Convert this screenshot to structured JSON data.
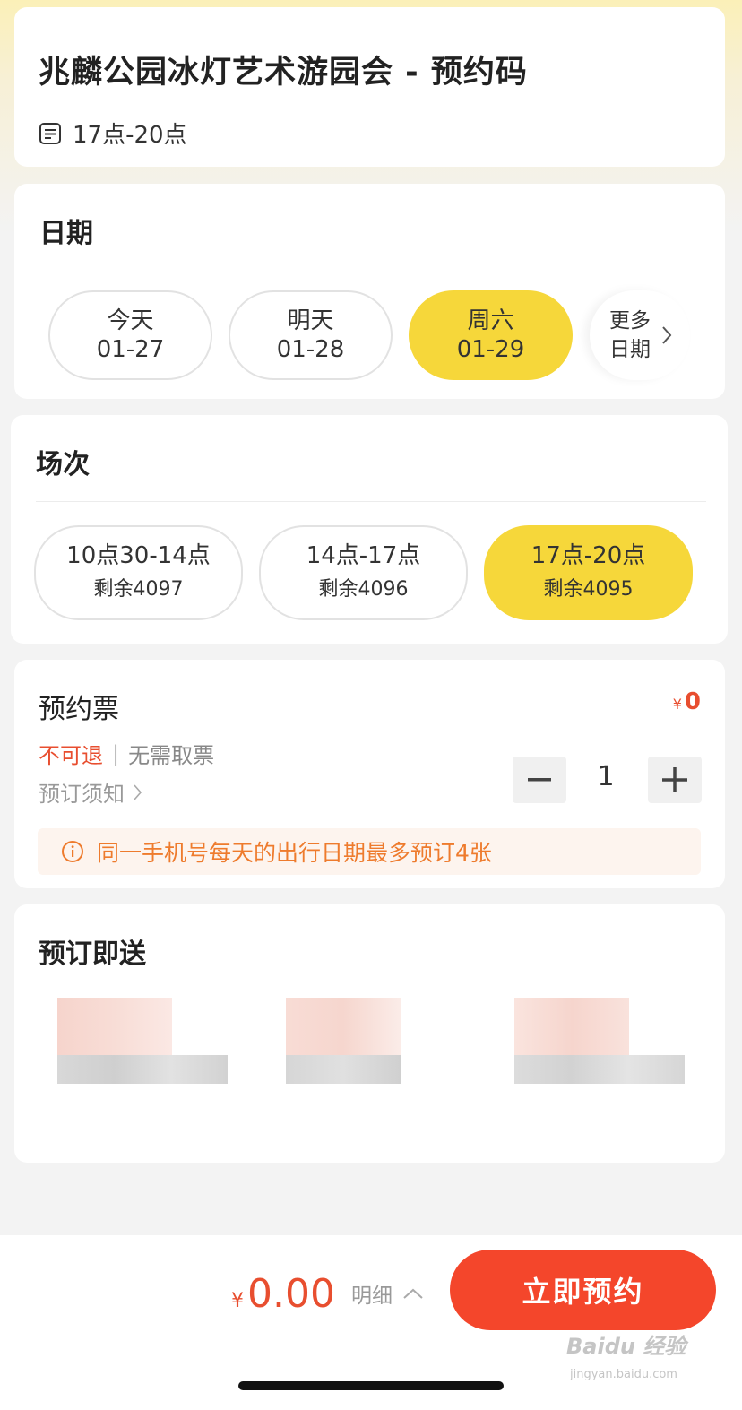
{
  "header": {
    "title": "兆麟公园冰灯艺术游园会 - 预约码",
    "session_time": "17点-20点",
    "icon": "document-list-icon"
  },
  "date_section": {
    "title": "日期",
    "dates": [
      {
        "day": "今天",
        "date": "01-27",
        "selected": false
      },
      {
        "day": "明天",
        "date": "01-28",
        "selected": false
      },
      {
        "day": "周六",
        "date": "01-29",
        "selected": true
      }
    ],
    "more_line1": "更多",
    "more_line2": "日期"
  },
  "session_section": {
    "title": "场次",
    "sessions": [
      {
        "time": "10点30-14点",
        "remaining": "剩余4097",
        "selected": false
      },
      {
        "time": "14点-17点",
        "remaining": "剩余4096",
        "selected": false
      },
      {
        "time": "17点-20点",
        "remaining": "剩余4095",
        "selected": true
      }
    ]
  },
  "ticket_section": {
    "title": "预约票",
    "currency": "¥",
    "price": "0",
    "non_refundable": "不可退",
    "separator": "|",
    "no_pickup": "无需取票",
    "booking_notice": "预订须知",
    "quantity": "1",
    "limit_notice": "同一手机号每天的出行日期最多预订4张"
  },
  "gift_section": {
    "title": "预订即送"
  },
  "bottom_bar": {
    "currency": "¥",
    "total": "0.00",
    "detail_label": "明细",
    "book_button": "立即预约"
  },
  "watermark": {
    "brand": "Baidu 经验",
    "url": "jingyan.baidu.com"
  },
  "colors": {
    "accent_yellow": "#f6d73a",
    "price_red": "#e84e2f",
    "button_red": "#f4462b",
    "warning_orange": "#ee7b2d"
  }
}
